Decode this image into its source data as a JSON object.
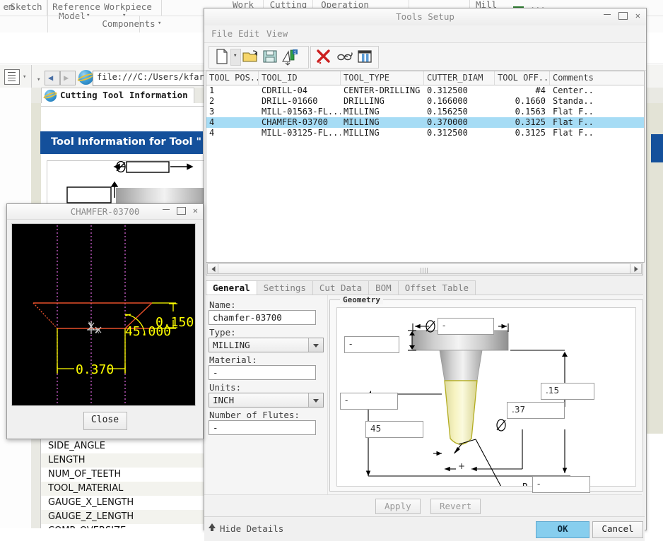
{
  "background_app": {
    "ribbon_items": [
      "Sketch",
      "Reference\nModel",
      "Workpiece"
    ],
    "ribbon_left_partial": "em",
    "ribbon_item_sketch": "Sketch",
    "ribbon_item_reference_model": "Reference",
    "ribbon_item_reference_model2": "Model",
    "ribbon_item_workpiece": "Workpiece",
    "ribbon_components": "Components",
    "ribbon_work": "Work",
    "ribbon_cutting": "Cutting",
    "ribbon_operation": "Operation",
    "ribbon_mill": "Mill",
    "browser": {
      "url": "file:///C:/Users/kfar",
      "tab_label": "Cutting Tool Information"
    },
    "tool_info_header": "Tool Information for Tool \"",
    "param_rows": [
      {
        "label": "SIDE_ANGLE",
        "alt": false
      },
      {
        "label": "LENGTH",
        "alt": true
      },
      {
        "label": "NUM_OF_TEETH",
        "alt": false
      },
      {
        "label": "TOOL_MATERIAL",
        "alt": true
      },
      {
        "label": "GAUGE_X_LENGTH",
        "alt": false
      },
      {
        "label": "GAUGE_Z_LENGTH",
        "alt": true
      },
      {
        "label": "COMP_OVERSIZE",
        "alt": false
      }
    ],
    "param_dash_top": "-",
    "param_dash_bottom": "-"
  },
  "tools_setup": {
    "title": "Tools Setup",
    "menu": [
      "File",
      "Edit",
      "View"
    ],
    "toolbar_icons": [
      "new-document-icon",
      "new-document-dropdown-icon",
      "open-folder-icon",
      "save-disk-icon",
      "sort-tools-icon",
      "delete-red-x-icon",
      "preview-glasses-icon",
      "columns-table-icon"
    ],
    "table": {
      "columns": [
        "TOOL POS...",
        "TOOL_ID",
        "TOOL_TYPE",
        "CUTTER_DIAM",
        "TOOL OFF...",
        "Comments"
      ],
      "rows": [
        {
          "pos": "1",
          "id": "CDRILL-04",
          "type": "CENTER-DRILLING",
          "diam": "0.312500",
          "off": "#4",
          "comments": "Center..",
          "selected": false
        },
        {
          "pos": "2",
          "id": "DRILL-01660",
          "type": "DRILLING",
          "diam": "0.166000",
          "off": "0.1660",
          "comments": "Standa..",
          "selected": false
        },
        {
          "pos": "3",
          "id": "MILL-01563-FL...",
          "type": "MILLING",
          "diam": "0.156250",
          "off": "0.1563",
          "comments": "Flat F..",
          "selected": false
        },
        {
          "pos": "4",
          "id": "CHAMFER-03700",
          "type": "MILLING",
          "diam": "0.370000",
          "off": "0.3125",
          "comments": "Flat F..",
          "selected": true
        },
        {
          "pos": "4",
          "id": "MILL-03125-FL...",
          "type": "MILLING",
          "diam": "0.312500",
          "off": "0.3125",
          "comments": "Flat F..",
          "selected": false
        }
      ]
    },
    "tabs": [
      {
        "label": "General",
        "active": true
      },
      {
        "label": "Settings",
        "active": false
      },
      {
        "label": "Cut Data",
        "active": false
      },
      {
        "label": "BOM",
        "active": false
      },
      {
        "label": "Offset Table",
        "active": false
      }
    ],
    "general_form": {
      "name_label": "Name:",
      "name_value": "chamfer-03700",
      "type_label": "Type:",
      "type_value": "MILLING",
      "material_label": "Material:",
      "material_value": "-",
      "units_label": "Units:",
      "units_value": "INCH",
      "flutes_label": "Number of Flutes:",
      "flutes_value": "-"
    },
    "geometry": {
      "legend": "Geometry",
      "fields": {
        "top_diameter": "-",
        "head_height": "-",
        "shoulder_length": "-",
        "angle": "45",
        "cutter_diameter": ".37",
        "flute_length": ".15",
        "corner_radius": "-",
        "radius_label": "R",
        "diameter_symbol": "⌀"
      }
    },
    "apply_label": "Apply",
    "revert_label": "Revert",
    "hide_details_label": "Hide Details",
    "ok_label": "OK",
    "cancel_label": "Cancel"
  },
  "chamfer_dialog": {
    "title": "CHAMFER-03700",
    "close_label": "Close",
    "dimensions": {
      "height": "0.150",
      "angle": "45.000",
      "width": "0.370",
      "axis_label": "X"
    }
  },
  "colors": {
    "selection_blue": "#a6dcf5",
    "ok_button": "#87ceee",
    "header_blue": "#14509b",
    "canvas_black": "#000000",
    "dim_yellow": "#ffff00",
    "geom_orange": "#ff7f27",
    "tool_yellow": "#f2f0a0"
  }
}
